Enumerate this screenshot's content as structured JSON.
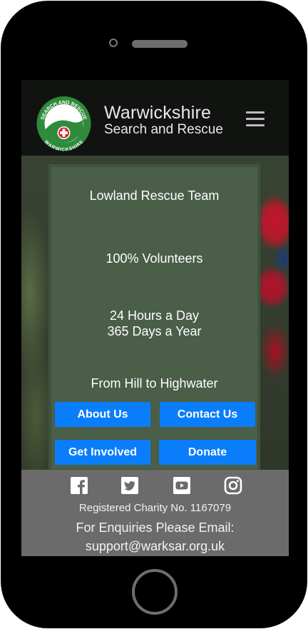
{
  "brand": {
    "line1": "Warwickshire",
    "line2": "Search and Rescue",
    "logo_text_top": "SEARCH AND RESCUE",
    "logo_text_bottom": "WARWICKSHIRE"
  },
  "slogans": [
    {
      "text": "Lowland Rescue Team"
    },
    {
      "text": "100% Volunteers"
    },
    {
      "text": "24 Hours a Day 365 Days a Year"
    },
    {
      "text": "From Hill to Highwater"
    }
  ],
  "buttons": {
    "about": "About Us",
    "contact": "Contact Us",
    "involved": "Get Involved",
    "donate": "Donate"
  },
  "footer": {
    "charity": "Registered Charity No. 1167079",
    "enquiries": "For Enquiries Please Email:",
    "email": "support@warksar.org.uk"
  },
  "social": [
    "facebook-icon",
    "twitter-icon",
    "youtube-icon",
    "instagram-icon"
  ],
  "colors": {
    "button": "#0a7dfb",
    "panel": "#4a5e48",
    "header": "#111311",
    "footer": "#6b6b6b",
    "logo_green": "#2f8a3a",
    "logo_red": "#d61f26"
  }
}
